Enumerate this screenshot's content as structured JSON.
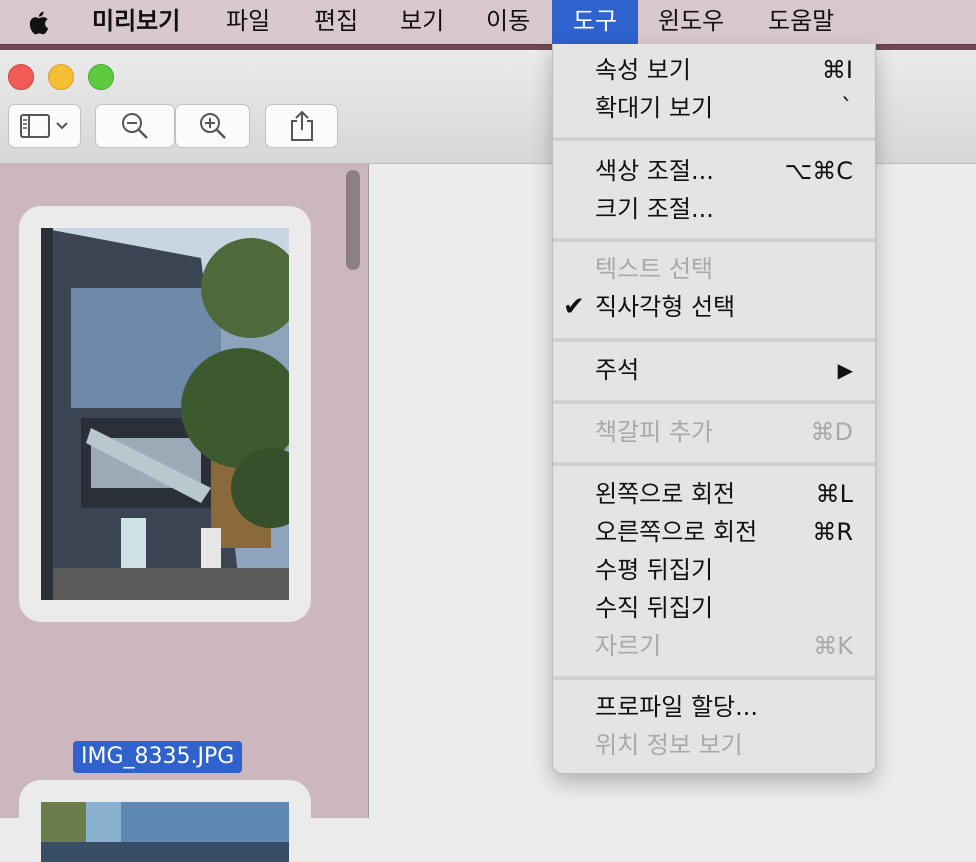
{
  "menubar": {
    "app": "미리보기",
    "items": [
      "파일",
      "편집",
      "보기",
      "이동",
      "도구",
      "윈도우",
      "도움말"
    ],
    "active": "도구"
  },
  "sidebar": {
    "thumbnails": [
      {
        "filename": "IMG_8335.JPG",
        "selected": true
      },
      {
        "filename": "",
        "selected": false
      }
    ]
  },
  "tools_menu": {
    "groups": [
      [
        {
          "label": "속성 보기",
          "shortcut": "⌘I",
          "enabled": true
        },
        {
          "label": "확대기 보기",
          "shortcut": "`",
          "enabled": true
        }
      ],
      [
        {
          "label": "색상 조절...",
          "shortcut": "⌥⌘C",
          "enabled": true
        },
        {
          "label": "크기 조절...",
          "shortcut": "",
          "enabled": true
        }
      ],
      [
        {
          "label": "텍스트 선택",
          "shortcut": "",
          "enabled": false
        },
        {
          "label": "직사각형 선택",
          "shortcut": "",
          "enabled": true,
          "checked": true
        }
      ],
      [
        {
          "label": "주석",
          "shortcut": "▶",
          "enabled": true
        }
      ],
      [
        {
          "label": "책갈피 추가",
          "shortcut": "⌘D",
          "enabled": false
        }
      ],
      [
        {
          "label": "왼쪽으로 회전",
          "shortcut": "⌘L",
          "enabled": true
        },
        {
          "label": "오른쪽으로 회전",
          "shortcut": "⌘R",
          "enabled": true
        },
        {
          "label": "수평 뒤집기",
          "shortcut": "",
          "enabled": true
        },
        {
          "label": "수직 뒤집기",
          "shortcut": "",
          "enabled": true
        },
        {
          "label": "자르기",
          "shortcut": "⌘K",
          "enabled": false
        }
      ],
      [
        {
          "label": "프로파일 할당...",
          "shortcut": "",
          "enabled": true
        },
        {
          "label": "위치 정보 보기",
          "shortcut": "",
          "enabled": false
        }
      ]
    ]
  },
  "colors": {
    "accent": "#2e62cf",
    "sidebar": "#cbb7bd",
    "menubar": "#d9c9ce"
  }
}
